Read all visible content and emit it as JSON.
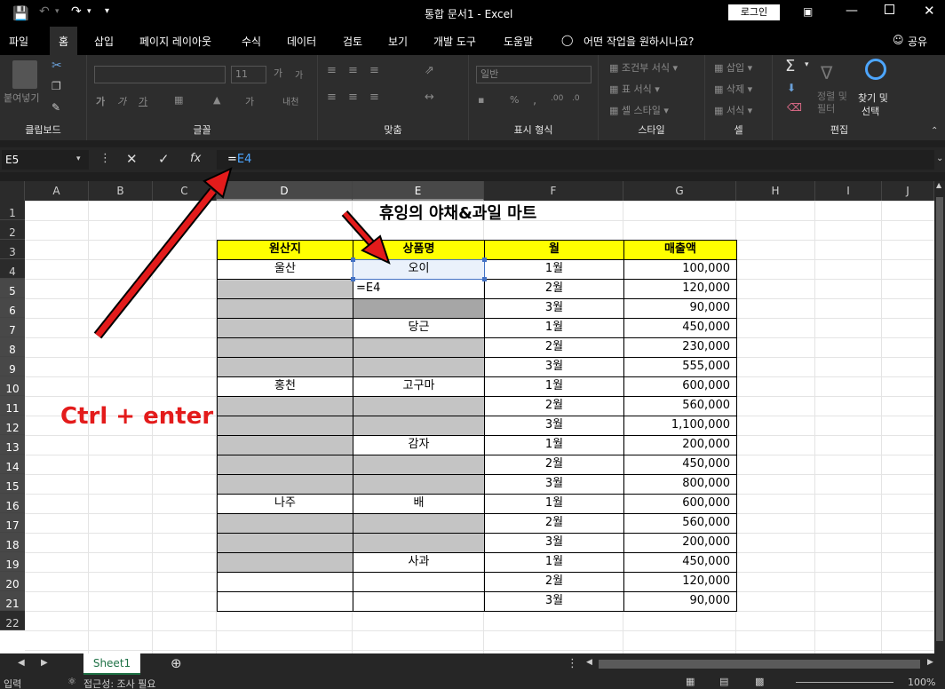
{
  "window": {
    "title": "통합 문서1  -  Excel",
    "login_label": "로그인"
  },
  "ribbon_tabs": [
    "파일",
    "홈",
    "삽입",
    "페이지 레이아웃",
    "수식",
    "데이터",
    "검토",
    "보기",
    "개발 도구",
    "도움말"
  ],
  "tell_me": "어떤 작업을 원하시나요?",
  "share_label": "공유",
  "ribbon": {
    "clipboard": {
      "label": "클립보드",
      "paste": "붙여넣기"
    },
    "font": {
      "label": "글꼴",
      "size": "11"
    },
    "alignment": {
      "label": "맞춤"
    },
    "number": {
      "label": "표시 형식",
      "format": "일반"
    },
    "styles": {
      "label": "스타일",
      "conditional": "조건부 서식",
      "table": "표 서식",
      "cell_styles": "셀 스타일"
    },
    "cells": {
      "label": "셀",
      "insert": "삽입",
      "delete": "삭제",
      "format": "서식"
    },
    "editing": {
      "label": "편집",
      "sort": "정렬 및 필터",
      "find1": "찾기 및",
      "find2": "선택"
    }
  },
  "formula_bar": {
    "name_box": "E5",
    "formula_eq": "=",
    "formula_ref": "E4"
  },
  "columns": [
    "A",
    "B",
    "C",
    "D",
    "E",
    "F",
    "G",
    "H",
    "I",
    "J"
  ],
  "rows": [
    "1",
    "2",
    "3",
    "4",
    "5",
    "6",
    "7",
    "8",
    "9",
    "10",
    "11",
    "12",
    "13",
    "14",
    "15",
    "16",
    "17",
    "18",
    "19",
    "20",
    "21",
    "22"
  ],
  "sheet": {
    "title": "휴잉의 야채&과일 마트",
    "headers": [
      "원산지",
      "상품명",
      "월",
      "매출액"
    ],
    "table_rows": [
      {
        "origin": "울산",
        "product": "오이",
        "month": "1월",
        "sales": "100,000"
      },
      {
        "origin": "",
        "product": "=E4",
        "month": "2월",
        "sales": "120,000"
      },
      {
        "origin": "",
        "product": "",
        "month": "3월",
        "sales": "90,000"
      },
      {
        "origin": "",
        "product": "당근",
        "month": "1월",
        "sales": "450,000"
      },
      {
        "origin": "",
        "product": "",
        "month": "2월",
        "sales": "230,000"
      },
      {
        "origin": "",
        "product": "",
        "month": "3월",
        "sales": "555,000"
      },
      {
        "origin": "홍천",
        "product": "고구마",
        "month": "1월",
        "sales": "600,000"
      },
      {
        "origin": "",
        "product": "",
        "month": "2월",
        "sales": "560,000"
      },
      {
        "origin": "",
        "product": "",
        "month": "3월",
        "sales": "1,100,000"
      },
      {
        "origin": "",
        "product": "감자",
        "month": "1월",
        "sales": "200,000"
      },
      {
        "origin": "",
        "product": "",
        "month": "2월",
        "sales": "450,000"
      },
      {
        "origin": "",
        "product": "",
        "month": "3월",
        "sales": "800,000"
      },
      {
        "origin": "나주",
        "product": "배",
        "month": "1월",
        "sales": "600,000"
      },
      {
        "origin": "",
        "product": "",
        "month": "2월",
        "sales": "560,000"
      },
      {
        "origin": "",
        "product": "",
        "month": "3월",
        "sales": "200,000"
      },
      {
        "origin": "",
        "product": "사과",
        "month": "1월",
        "sales": "450,000"
      },
      {
        "origin": "",
        "product": "",
        "month": "2월",
        "sales": "120,000"
      },
      {
        "origin": "",
        "product": "",
        "month": "3월",
        "sales": "90,000"
      }
    ]
  },
  "annotation": "Ctrl + enter",
  "sheet_tab": "Sheet1",
  "status": {
    "mode": "입력",
    "accessibility": "접근성: 조사 필요",
    "zoom": "100%"
  },
  "colors": {
    "header_fill": "#ffff00",
    "grey_fill": "#c4c4c4",
    "arrow": "#e31b1b",
    "sheet_tab": "#1e7145"
  }
}
